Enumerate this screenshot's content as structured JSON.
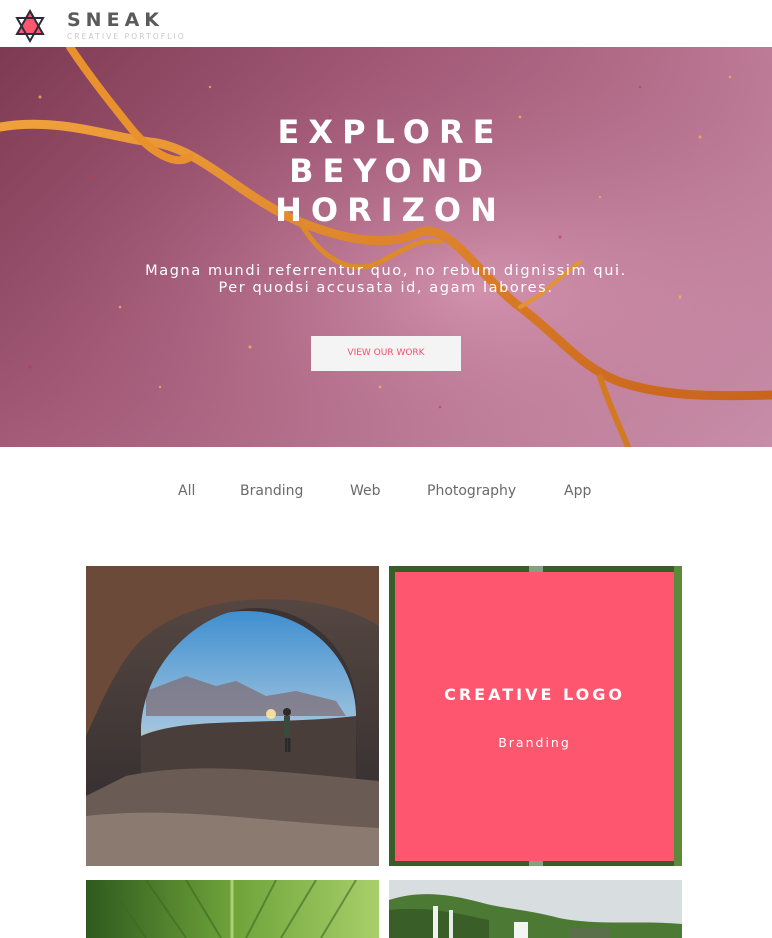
{
  "brand": {
    "name": "SNEAK",
    "tagline": "CREATIVE PORTOFLIO",
    "colors": {
      "accent": "#ff5670",
      "dark": "#2b2b3a"
    }
  },
  "hero": {
    "title_lines": [
      "EXPLORE",
      "BEYOND",
      "HORIZON"
    ],
    "subtitle_lines": [
      "Magna mundi referrentur quo, no rebum dignissim qui.",
      "Per quodsi accusata id, agam labores."
    ],
    "cta_label": "VIEW OUR WORK"
  },
  "filters": [
    "All",
    "Branding",
    "Web",
    "Photography",
    "App"
  ],
  "portfolio": {
    "items": [
      {
        "image": "desert-arch-photo"
      },
      {
        "image": "waterfall-forest-photo",
        "overlay_title": "CREATIVE LOGO",
        "overlay_category": "Branding"
      },
      {
        "image": "green-leaf-photo"
      },
      {
        "image": "waterfall-landscape-photo"
      }
    ]
  }
}
